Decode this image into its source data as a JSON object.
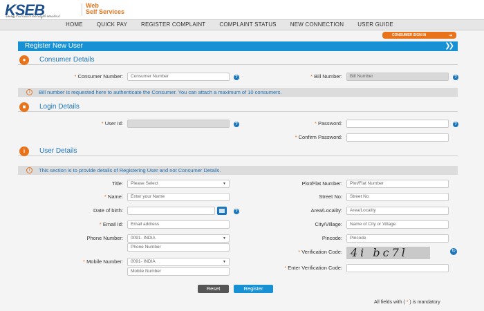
{
  "header": {
    "logo": "KSEB",
    "logo_sub": "കേരള സംസ്ഥാന വൈദ്യുതി ബോർഡ്",
    "web": "Web",
    "self_services": "Self Services"
  },
  "nav": [
    "HOME",
    "QUICK PAY",
    "REGISTER COMPLAINT",
    "COMPLAINT STATUS",
    "NEW CONNECTION",
    "USER GUIDE"
  ],
  "consumer_sign_in": "CONSUMER SIGN IN",
  "page_title": "Register New User",
  "consumer_details": {
    "title": "Consumer Details",
    "consumer_number_label": "Consumer Number:",
    "consumer_number_placeholder": "Consumer Number",
    "bill_number_label": "Bill Number:",
    "bill_number_placeholder": "Bill Number",
    "info": "Bill number is requested here to authenticate the Consumer. You can attach a maximum of 10 consumers."
  },
  "login_details": {
    "title": "Login Details",
    "user_id_label": "User Id:",
    "password_label": "Password:",
    "confirm_password_label": "Confirm Password:"
  },
  "user_details": {
    "title": "User Details",
    "info": "This section is to provide details of Registering User and not Consumer Details.",
    "title_label": "Title:",
    "title_value": "Please Select",
    "name_label": "Name:",
    "name_placeholder": "Enter your Name",
    "dob_label": "Date of birth:",
    "email_label": "Email Id:",
    "email_placeholder": "Email address",
    "phone_label": "Phone Number:",
    "phone_code": "0091- INDIA",
    "phone_placeholder": "Phone Number",
    "mobile_label": "Mobile Number:",
    "mobile_code": "0091- INDIA",
    "mobile_placeholder": "Mobile Number",
    "plot_label": "Plot/Flat Number:",
    "plot_placeholder": "Plot/Flat Number",
    "street_label": "Street No:",
    "street_placeholder": "Street No",
    "area_label": "Area/Locality:",
    "area_placeholder": "Area/Locality",
    "city_label": "City/Village:",
    "city_placeholder": "Name of City or Village",
    "pincode_label": "Pincode:",
    "pincode_placeholder": "Pincode",
    "verification_label": "Verification Code:",
    "captcha_text": "4i bc7l",
    "enter_verification_label": "Enter Verification Code:"
  },
  "buttons": {
    "reset": "Reset",
    "register": "Register"
  },
  "footnote_prefix": "All fields with (",
  "footnote_star": "*",
  "footnote_suffix": ") is mandatory"
}
